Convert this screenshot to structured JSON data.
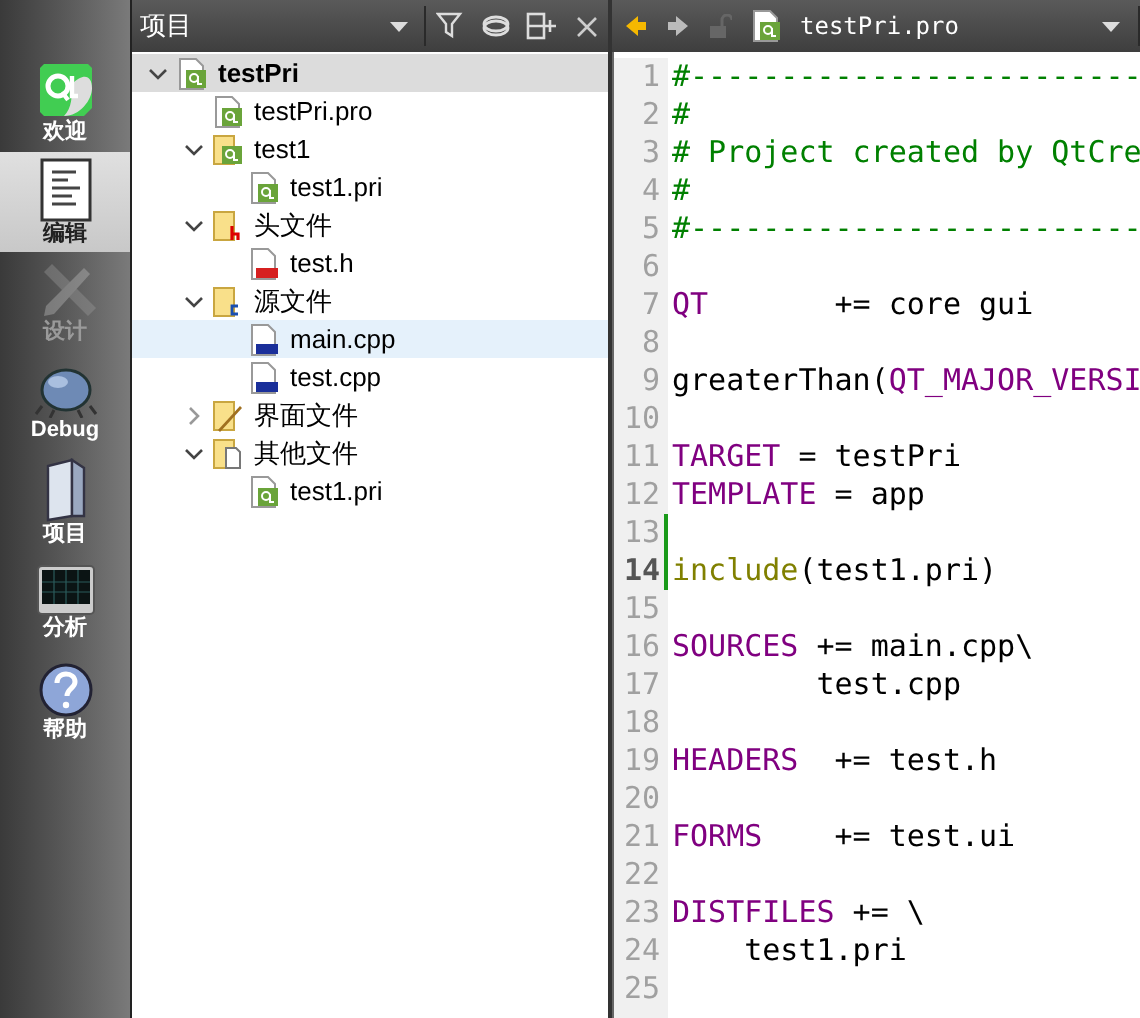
{
  "modes": [
    {
      "label": "欢迎",
      "kind": "qt",
      "selected": false,
      "disabled": false
    },
    {
      "label": "编辑",
      "kind": "edit",
      "selected": true,
      "disabled": false
    },
    {
      "label": "设计",
      "kind": "design",
      "selected": false,
      "disabled": true
    },
    {
      "label": "Debug",
      "kind": "debug",
      "selected": false,
      "disabled": false
    },
    {
      "label": "项目",
      "kind": "project",
      "selected": false,
      "disabled": false
    },
    {
      "label": "分析",
      "kind": "analyze",
      "selected": false,
      "disabled": false
    },
    {
      "label": "帮助",
      "kind": "help",
      "selected": false,
      "disabled": false
    }
  ],
  "project_panel": {
    "title": "项目",
    "tree": [
      {
        "label": "testPri",
        "kind": "project",
        "expanded": true,
        "selected": false,
        "children": [
          {
            "label": "testPri.pro",
            "kind": "pro",
            "selected": false
          },
          {
            "label": "test1",
            "kind": "pro-folder",
            "expanded": true,
            "selected": false,
            "children": [
              {
                "label": "test1.pri",
                "kind": "pro",
                "selected": false
              }
            ]
          },
          {
            "label": "头文件",
            "kind": "h-folder",
            "expanded": true,
            "selected": false,
            "children": [
              {
                "label": "test.h",
                "kind": "h",
                "selected": false
              }
            ]
          },
          {
            "label": "源文件",
            "kind": "cpp-folder",
            "expanded": true,
            "selected": false,
            "children": [
              {
                "label": "main.cpp",
                "kind": "cpp",
                "selected": true
              },
              {
                "label": "test.cpp",
                "kind": "cpp",
                "selected": false
              }
            ]
          },
          {
            "label": "界面文件",
            "kind": "ui-folder",
            "expanded": false,
            "selected": false
          },
          {
            "label": "其他文件",
            "kind": "other-folder",
            "expanded": true,
            "selected": false,
            "children": [
              {
                "label": "test1.pri",
                "kind": "pro",
                "selected": false
              }
            ]
          }
        ]
      }
    ]
  },
  "editor": {
    "file": "testPri.pro",
    "lines": [
      {
        "number": "1",
        "modified": false,
        "current": false,
        "tokens": [
          {
            "kind": "comment",
            "text": "#-------------------------"
          }
        ]
      },
      {
        "number": "2",
        "modified": false,
        "current": false,
        "tokens": [
          {
            "kind": "comment",
            "text": "#"
          }
        ]
      },
      {
        "number": "3",
        "modified": false,
        "current": false,
        "tokens": [
          {
            "kind": "comment",
            "text": "# Project created by QtCre"
          }
        ]
      },
      {
        "number": "4",
        "modified": false,
        "current": false,
        "tokens": [
          {
            "kind": "comment",
            "text": "#"
          }
        ]
      },
      {
        "number": "5",
        "modified": false,
        "current": false,
        "tokens": [
          {
            "kind": "comment",
            "text": "#-------------------------"
          }
        ]
      },
      {
        "number": "6",
        "modified": false,
        "current": false
      },
      {
        "number": "7",
        "modified": false,
        "current": false,
        "tokens": [
          {
            "kind": "keyword",
            "text": "QT"
          },
          {
            "kind": "plain",
            "text": "       += core gui"
          }
        ]
      },
      {
        "number": "8",
        "modified": false,
        "current": false
      },
      {
        "number": "9",
        "modified": false,
        "current": false,
        "tokens": [
          {
            "kind": "plain",
            "text": "greaterThan("
          },
          {
            "kind": "keyword",
            "text": "QT_MAJOR_VERSI"
          }
        ]
      },
      {
        "number": "10",
        "modified": false,
        "current": false
      },
      {
        "number": "11",
        "modified": false,
        "current": false,
        "tokens": [
          {
            "kind": "keyword",
            "text": "TARGET"
          },
          {
            "kind": "plain",
            "text": " = testPri"
          }
        ]
      },
      {
        "number": "12",
        "modified": false,
        "current": false,
        "tokens": [
          {
            "kind": "keyword",
            "text": "TEMPLATE"
          },
          {
            "kind": "plain",
            "text": " = app"
          }
        ]
      },
      {
        "number": "13",
        "modified": true,
        "current": false
      },
      {
        "number": "14",
        "modified": true,
        "current": true,
        "tokens": [
          {
            "kind": "function",
            "text": "include"
          },
          {
            "kind": "plain",
            "text": "(test1.pri)"
          }
        ]
      },
      {
        "number": "15",
        "modified": false,
        "current": false
      },
      {
        "number": "16",
        "modified": false,
        "current": false,
        "tokens": [
          {
            "kind": "keyword",
            "text": "SOURCES"
          },
          {
            "kind": "plain",
            "text": " += main.cpp\\"
          }
        ]
      },
      {
        "number": "17",
        "modified": false,
        "current": false,
        "tokens": [
          {
            "kind": "plain",
            "text": "        test.cpp"
          }
        ]
      },
      {
        "number": "18",
        "modified": false,
        "current": false
      },
      {
        "number": "19",
        "modified": false,
        "current": false,
        "tokens": [
          {
            "kind": "keyword",
            "text": "HEADERS"
          },
          {
            "kind": "plain",
            "text": "  += test.h"
          }
        ]
      },
      {
        "number": "20",
        "modified": false,
        "current": false
      },
      {
        "number": "21",
        "modified": false,
        "current": false,
        "tokens": [
          {
            "kind": "keyword",
            "text": "FORMS"
          },
          {
            "kind": "plain",
            "text": "    += test.ui"
          }
        ]
      },
      {
        "number": "22",
        "modified": false,
        "current": false
      },
      {
        "number": "23",
        "modified": false,
        "current": false,
        "tokens": [
          {
            "kind": "keyword",
            "text": "DISTFILES"
          },
          {
            "kind": "plain",
            "text": " += \\"
          }
        ]
      },
      {
        "number": "24",
        "modified": false,
        "current": false,
        "tokens": [
          {
            "kind": "plain",
            "text": "    test1.pri"
          }
        ]
      },
      {
        "number": "25",
        "modified": false,
        "current": false
      }
    ]
  }
}
